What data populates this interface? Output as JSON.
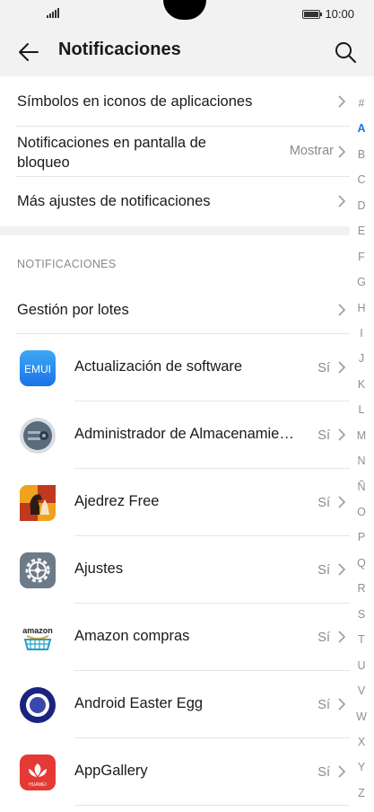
{
  "status_bar": {
    "time": "10:00"
  },
  "header": {
    "title": "Notificaciones"
  },
  "settings": [
    {
      "label": "Símbolos en iconos de aplicaciones",
      "value": ""
    },
    {
      "label_line1": "Notificaciones en pantalla de",
      "label_line2": "bloqueo",
      "value": "Mostrar"
    },
    {
      "label": "Más ajustes de notificaciones",
      "value": ""
    }
  ],
  "section_title": "NOTIFICACIONES",
  "batch": {
    "label": "Gestión por lotes"
  },
  "apps": [
    {
      "name": "Actualización de software",
      "value": "Sí",
      "icon": "emui-icon"
    },
    {
      "name": "Administrador de Almacenamie…",
      "value": "Sí",
      "icon": "storage-manager-icon"
    },
    {
      "name": "Ajedrez Free",
      "value": "Sí",
      "icon": "chess-icon"
    },
    {
      "name": "Ajustes",
      "value": "Sí",
      "icon": "settings-gear-icon"
    },
    {
      "name": "Amazon compras",
      "value": "Sí",
      "icon": "amazon-icon"
    },
    {
      "name": "Android Easter Egg",
      "value": "Sí",
      "icon": "easter-egg-icon"
    },
    {
      "name": "AppGallery",
      "value": "Sí",
      "icon": "appgallery-icon"
    }
  ],
  "icon_text": {
    "emui": "EMUI",
    "amazon": "amazon",
    "huawei": "HUAWEI"
  },
  "index": [
    "#",
    "A",
    "B",
    "C",
    "D",
    "E",
    "F",
    "G",
    "H",
    "I",
    "J",
    "K",
    "L",
    "M",
    "N",
    "Ñ",
    "O",
    "P",
    "Q",
    "R",
    "S",
    "T",
    "U",
    "V",
    "W",
    "X",
    "Y",
    "Z"
  ],
  "index_active": "A",
  "colors": {
    "accent": "#1a73e8",
    "header_bg": "#f2f2f2",
    "secondary_text": "#8a8a8a"
  }
}
